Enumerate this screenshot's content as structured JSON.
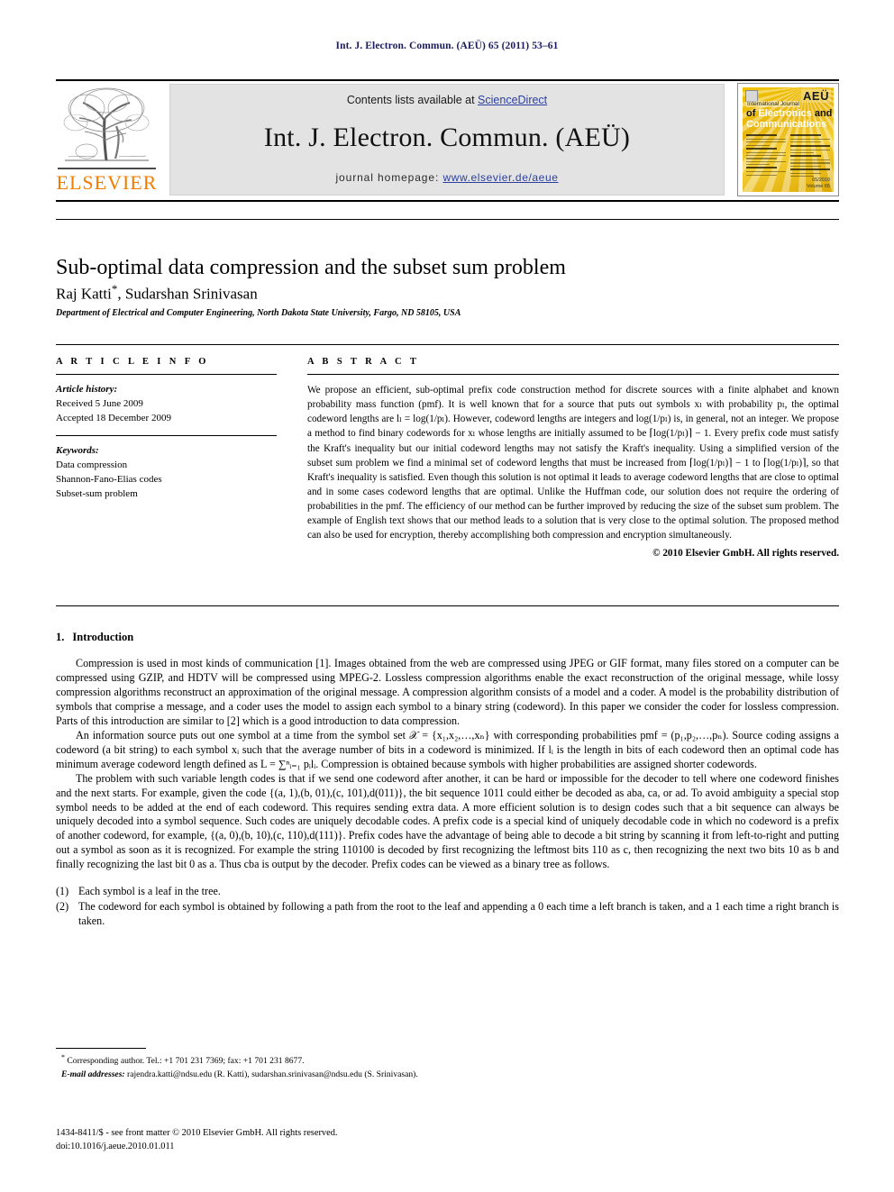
{
  "running_head": "Int. J. Electron. Commun. (AEÜ) 65 (2011) 53–61",
  "banner": {
    "contents_prefix": "Contents lists available at ",
    "sciencedirect": "ScienceDirect",
    "journal_title": "Int. J. Electron. Commun. (AEÜ)",
    "homepage_prefix": "journal homepage: ",
    "homepage_url": "www.elsevier.de/aeue",
    "publisher_wordmark": "ELSEVIER",
    "link_color": "#2b3f9e",
    "elsevier_orange": "#f07d00",
    "banner_bg": "#e3e3e3"
  },
  "cover": {
    "badge": "AEÜ",
    "line1": "International Journal",
    "line2_a": "of ",
    "line2_b": "Electronics",
    "line2_c": " and",
    "line3": "Communications",
    "contents_label": "Contents",
    "issue_line1": "65/2010",
    "issue_line2": "Volume 65",
    "cover_color": "#e8b711"
  },
  "article": {
    "title": "Sub-optimal data compression and the subset sum problem",
    "authors": "Raj Katti",
    "author_mark": "*",
    "authors_rest": ", Sudarshan Srinivasan",
    "affiliation": "Department of Electrical and Computer Engineering, North Dakota State University, Fargo, ND 58105, USA"
  },
  "info": {
    "heading": "A R T I C L E   I N F O",
    "history_label": "Article history:",
    "history": [
      "Received 5 June 2009",
      "Accepted 18 December 2009"
    ],
    "keywords_label": "Keywords:",
    "keywords": [
      "Data compression",
      "Shannon-Fano-Elias codes",
      "Subset-sum problem"
    ]
  },
  "abstract": {
    "heading": "A B S T R A C T",
    "paragraph": "We propose an efficient, sub-optimal prefix code construction method for discrete sources with a finite alphabet and known probability mass function (pmf). It is well known that for a source that puts out symbols xₗ with probability pₗ, the optimal codeword lengths are lₗ = log(1/pₗ). However, codeword lengths are integers and log(1/pₗ) is, in general, not an integer. We propose a method to find binary codewords for xₗ whose lengths are initially assumed to be ⌈log(1/pₗ)⌉ − 1. Every prefix code must satisfy the Kraft's inequality but our initial codeword lengths may not satisfy the Kraft's inequality. Using a simplified version of the subset sum problem we find a minimal set of codeword lengths that must be increased from ⌈log(1/pₗ)⌉ − 1 to ⌈log(1/pₗ)⌉, so that Kraft's inequality is satisfied. Even though this solution is not optimal it leads to average codeword lengths that are close to optimal and in some cases codeword lengths that are optimal. Unlike the Huffman code, our solution does not require the ordering of probabilities in the pmf. The efficiency of our method can be further improved by reducing the size of the subset sum problem. The example of English text shows that our method leads to a solution that is very close to the optimal solution. The proposed method can also be used for encryption, thereby accomplishing both compression and encryption simultaneously.",
    "copyright": "© 2010 Elsevier GmbH. All rights reserved."
  },
  "introduction": {
    "number": "1.",
    "title": "Introduction",
    "paragraphs": [
      "Compression is used in most kinds of communication [1]. Images obtained from the web are compressed using JPEG or GIF format, many files stored on a computer can be compressed using GZIP, and HDTV will be compressed using MPEG-2. Lossless compression algorithms enable the exact reconstruction of the original message, while lossy compression algorithms reconstruct an approximation of the original message. A compression algorithm consists of a model and a coder. A model is the probability distribution of symbols that comprise a message, and a coder uses the model to assign each symbol to a binary string (codeword). In this paper we consider the coder for lossless compression. Parts of this introduction are similar to [2] which is a good introduction to data compression.",
      "An information source puts out one symbol at a time from the symbol set 𝒳 = {x₁,x₂,…,xₙ} with corresponding probabilities pmf = (p₁,p₂,…,pₙ). Source coding assigns a codeword (a bit string) to each symbol xᵢ such that the average number of bits in a codeword is minimized. If lᵢ is the length in bits of each codeword then an optimal code has minimum average codeword length defined as L = ∑ⁿᵢ₌₁ pᵢlᵢ. Compression is obtained because symbols with higher probabilities are assigned shorter codewords.",
      "The problem with such variable length codes is that if we send one codeword after another, it can be hard or impossible for the decoder to tell where one codeword finishes and the next starts. For example, given the code {(a, 1),(b, 01),(c, 101),d(011)}, the bit sequence 1011 could either be decoded as aba, ca, or ad. To avoid ambiguity a special stop symbol needs to be added at the end of each codeword. This requires sending extra data. A more efficient solution is to design codes such that a bit sequence can always be uniquely decoded into a symbol sequence. Such codes are uniquely decodable codes. A prefix code is a special kind of uniquely decodable code in which no codeword is a prefix of another codeword, for example, {(a, 0),(b, 10),(c, 110),d(111)}. Prefix codes have the advantage of being able to decode a bit string by scanning it from left-to-right and putting out a symbol as soon as it is recognized. For example the string 110100 is decoded by first recognizing the leftmost bits 110 as c, then recognizing the next two bits 10 as b and finally recognizing the last bit 0 as a. Thus cba is output by the decoder. Prefix codes can be viewed as a binary tree as follows."
    ],
    "list": [
      {
        "marker": "(1)",
        "text": "Each symbol is a leaf in the tree."
      },
      {
        "marker": "(2)",
        "text": "The codeword for each symbol is obtained by following a path from the root to the leaf and appending a 0 each time a left branch is taken, and a 1 each time a right branch is taken."
      }
    ]
  },
  "footer": {
    "corresponding_mark": "*",
    "corresponding": "Corresponding author. Tel.: +1 701 231 7369; fax: +1 701 231 8677.",
    "email_label": "E-mail addresses:",
    "emails": "rajendra.katti@ndsu.edu (R. Katti), sudarshan.srinivasan@ndsu.edu (S. Srinivasan).",
    "issn_line": "1434-8411/$ - see front matter © 2010 Elsevier GmbH. All rights reserved.",
    "doi_line": "doi:10.1016/j.aeue.2010.01.011"
  }
}
